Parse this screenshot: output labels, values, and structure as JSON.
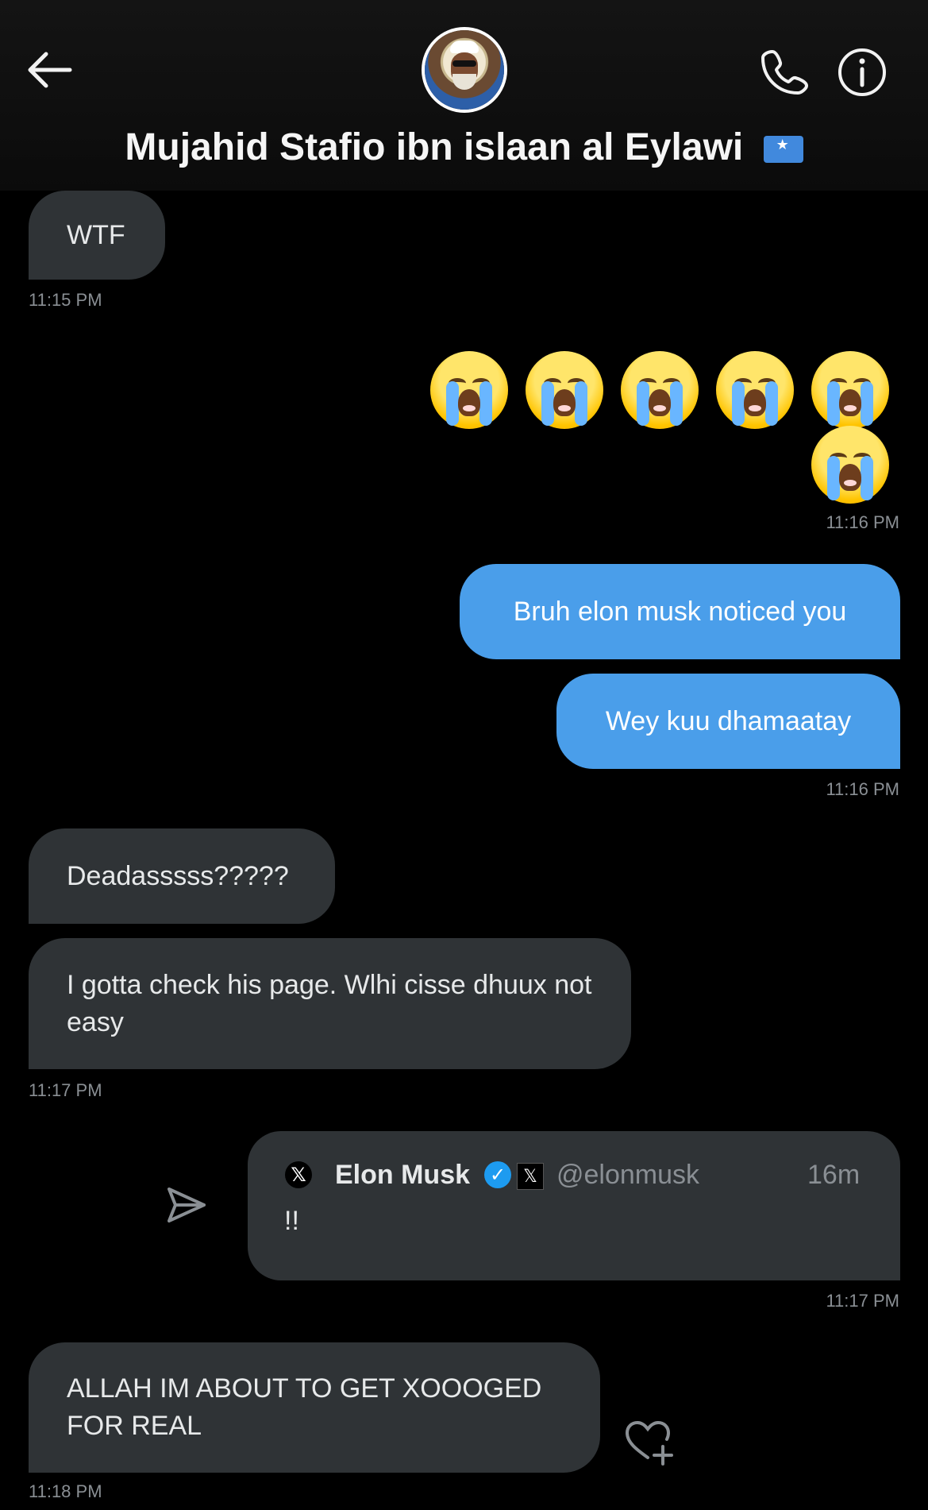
{
  "header": {
    "title": "Mujahid Stafio ibn islaan al Eylawi",
    "icons": [
      "arrow-left-icon",
      "avatar",
      "phone-icon",
      "info-icon"
    ]
  },
  "messages": {
    "first": {
      "text": "WTF",
      "time": "11:15 PM"
    },
    "emoji": {
      "icon": "loudly-crying-face-icon",
      "count": 6,
      "time": "11:16 PM"
    },
    "out1": {
      "text": "Bruh elon musk noticed you"
    },
    "out2": {
      "text": "Wey kuu dhamaatay",
      "time": "11:16 PM"
    },
    "in1": {
      "text": "Deadasssss?????"
    },
    "in2": {
      "text": "I gotta check his page. Wlhi cisse dhuux not easy",
      "time": "11:17 PM"
    },
    "quote": {
      "name": "Elon Musk",
      "handle": "@elonmusk",
      "age": "16m",
      "body": "!!",
      "time": "11:17 PM"
    },
    "last": {
      "text": "ALLAH IM ABOUT TO GET XOOOGED FOR REAL",
      "time": "11:18 PM"
    }
  },
  "colors": {
    "background": "#000000",
    "incoming": "#2f3336",
    "outgoing": "#4a9eea",
    "time": "#8a8f94"
  }
}
